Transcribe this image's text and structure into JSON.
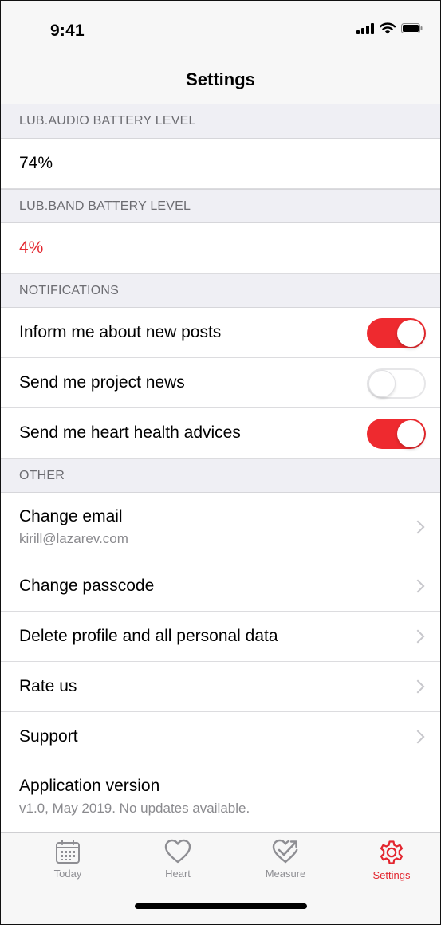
{
  "status_bar": {
    "time": "9:41"
  },
  "nav": {
    "title": "Settings"
  },
  "sections": {
    "audio_battery": {
      "header": "LUB.AUDIO BATTERY LEVEL",
      "value": "74%"
    },
    "band_battery": {
      "header": "LUB.BAND BATTERY LEVEL",
      "value": "4%",
      "value_color": "#e3262f"
    },
    "notifications": {
      "header": "NOTIFICATIONS",
      "items": [
        {
          "label": "Inform me about new posts",
          "enabled": true
        },
        {
          "label": "Send me project news",
          "enabled": false
        },
        {
          "label": "Send me heart health advices",
          "enabled": true
        }
      ]
    },
    "other": {
      "header": "OTHER",
      "change_email": {
        "label": "Change email",
        "value": "kirill@lazarev.com"
      },
      "change_passcode": {
        "label": "Change passcode"
      },
      "delete_profile": {
        "label": "Delete profile and all personal data"
      },
      "rate_us": {
        "label": "Rate us"
      },
      "support": {
        "label": "Support"
      },
      "app_version": {
        "label": "Application version",
        "value": "v1.0, May 2019. No updates available."
      }
    }
  },
  "tab_bar": {
    "tabs": [
      {
        "label": "Today",
        "icon": "calendar-icon",
        "active": false
      },
      {
        "label": "Heart",
        "icon": "heart-icon",
        "active": false
      },
      {
        "label": "Measure",
        "icon": "heart-check-icon",
        "active": false
      },
      {
        "label": "Settings",
        "icon": "gear-icon",
        "active": true
      }
    ]
  },
  "colors": {
    "accent": "#e3262f",
    "toggle_on": "#ee2a2f",
    "grouped_background": "#efeff4",
    "secondary_text": "#8a8a8e"
  }
}
